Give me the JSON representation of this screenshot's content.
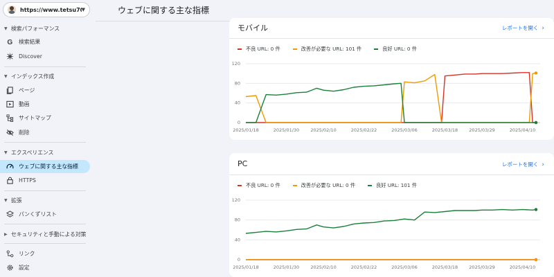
{
  "property": {
    "url": "https://www.tetsu7017..."
  },
  "page": {
    "title": "ウェブに関する主な指標"
  },
  "sidebar": {
    "sections": [
      {
        "label": "検索パフォーマンス",
        "items": [
          {
            "label": "検索結果",
            "icon": "google-g-icon"
          },
          {
            "label": "Discover",
            "icon": "discover-star-icon"
          }
        ]
      },
      {
        "label": "インデックス作成",
        "items": [
          {
            "label": "ページ",
            "icon": "pages-icon"
          },
          {
            "label": "動画",
            "icon": "video-icon"
          },
          {
            "label": "サイトマップ",
            "icon": "sitemap-icon"
          },
          {
            "label": "削除",
            "icon": "removal-icon"
          }
        ]
      },
      {
        "label": "エクスペリエンス",
        "items": [
          {
            "label": "ウェブに関する主な指標",
            "icon": "speed-icon",
            "active": true
          },
          {
            "label": "HTTPS",
            "icon": "lock-icon"
          }
        ]
      },
      {
        "label": "拡張",
        "items": [
          {
            "label": "パンくずリスト",
            "icon": "layers-icon"
          }
        ]
      },
      {
        "label": "セキュリティと手動による対策",
        "items": []
      }
    ],
    "bottom_items": [
      {
        "label": "リンク",
        "icon": "links-icon"
      },
      {
        "label": "設定",
        "icon": "settings-icon"
      }
    ]
  },
  "colors": {
    "poor": "#d93025",
    "needs_improvement": "#f29900",
    "good": "#188038",
    "link": "#1a73e8",
    "active_bg": "#c2e7ff"
  },
  "cards": [
    {
      "title": "モバイル",
      "report_link": "レポートを開く",
      "legend": [
        {
          "label": "不良 URL: 0 件"
        },
        {
          "label": "改善が必要な URL: 101 件"
        },
        {
          "label": "良好 URL: 0 件"
        }
      ]
    },
    {
      "title": "PC",
      "report_link": "レポートを開く",
      "legend": [
        {
          "label": "不良 URL: 0 件"
        },
        {
          "label": "改善が必要な URL: 0 件"
        },
        {
          "label": "良好 URL: 101 件"
        }
      ]
    }
  ],
  "chart_data": [
    {
      "type": "line",
      "title": "モバイル",
      "x": [
        "2025/01/18",
        "2025/01/21",
        "2025/01/24",
        "2025/01/27",
        "2025/01/30",
        "2025/02/02",
        "2025/02/05",
        "2025/02/08",
        "2025/02/10",
        "2025/02/13",
        "2025/02/16",
        "2025/02/19",
        "2025/02/22",
        "2025/02/25",
        "2025/02/28",
        "2025/03/03",
        "2025/03/05",
        "2025/03/06",
        "2025/03/09",
        "2025/03/12",
        "2025/03/15",
        "2025/03/17",
        "2025/03/18",
        "2025/03/21",
        "2025/03/24",
        "2025/03/27",
        "2025/03/29",
        "2025/04/01",
        "2025/04/04",
        "2025/04/07",
        "2025/04/10",
        "2025/04/12",
        "2025/04/13",
        "2025/04/14"
      ],
      "x_ticks": [
        "2025/01/18",
        "2025/01/30",
        "2025/02/10",
        "2025/02/22",
        "2025/03/06",
        "2025/03/18",
        "2025/03/29",
        "2025/04/10"
      ],
      "ylim": [
        0,
        120
      ],
      "y_ticks": [
        0,
        40,
        80,
        120
      ],
      "grid": true,
      "series": [
        {
          "name": "不良",
          "color": "#d93025",
          "values": [
            0,
            0,
            0,
            0,
            0,
            0,
            0,
            0,
            0,
            0,
            0,
            0,
            0,
            0,
            0,
            0,
            0,
            0,
            0,
            0,
            0,
            0,
            95,
            97,
            99,
            99,
            100,
            100,
            100,
            101,
            102,
            102,
            0,
            0
          ]
        },
        {
          "name": "改善が必要",
          "color": "#f29900",
          "values": [
            53,
            55,
            0,
            0,
            0,
            0,
            0,
            0,
            0,
            0,
            0,
            0,
            0,
            0,
            0,
            0,
            0,
            83,
            81,
            85,
            98,
            0,
            0,
            0,
            0,
            0,
            0,
            0,
            0,
            0,
            0,
            0,
            100,
            101
          ]
        },
        {
          "name": "良好",
          "color": "#188038",
          "values": [
            0,
            0,
            57,
            56,
            58,
            61,
            62,
            70,
            66,
            64,
            67,
            72,
            74,
            75,
            77,
            79,
            80,
            0,
            0,
            0,
            0,
            0,
            0,
            0,
            0,
            0,
            0,
            0,
            0,
            0,
            0,
            0,
            0,
            0
          ]
        }
      ]
    },
    {
      "type": "line",
      "title": "PC",
      "x": [
        "2025/01/18",
        "2025/01/21",
        "2025/01/24",
        "2025/01/27",
        "2025/01/30",
        "2025/02/02",
        "2025/02/05",
        "2025/02/08",
        "2025/02/10",
        "2025/02/13",
        "2025/02/16",
        "2025/02/19",
        "2025/02/22",
        "2025/02/25",
        "2025/02/28",
        "2025/03/03",
        "2025/03/06",
        "2025/03/09",
        "2025/03/12",
        "2025/03/15",
        "2025/03/18",
        "2025/03/21",
        "2025/03/24",
        "2025/03/27",
        "2025/03/29",
        "2025/04/01",
        "2025/04/04",
        "2025/04/07",
        "2025/04/10",
        "2025/04/13",
        "2025/04/14"
      ],
      "x_ticks": [
        "2025/01/18",
        "2025/01/30",
        "2025/02/10",
        "2025/02/22",
        "2025/03/06",
        "2025/03/18",
        "2025/03/29",
        "2025/04/10"
      ],
      "ylim": [
        0,
        120
      ],
      "y_ticks": [
        0,
        40,
        80,
        120
      ],
      "grid": true,
      "series": [
        {
          "name": "不良",
          "color": "#d93025",
          "values": [
            0,
            0,
            0,
            0,
            0,
            0,
            0,
            0,
            0,
            0,
            0,
            0,
            0,
            0,
            0,
            0,
            0,
            0,
            0,
            0,
            0,
            0,
            0,
            0,
            0,
            0,
            0,
            0,
            0,
            0,
            0
          ]
        },
        {
          "name": "改善が必要",
          "color": "#f29900",
          "values": [
            0,
            0,
            0,
            0,
            0,
            0,
            0,
            0,
            0,
            0,
            0,
            0,
            0,
            0,
            0,
            0,
            0,
            0,
            0,
            0,
            0,
            0,
            0,
            0,
            0,
            0,
            0,
            0,
            0,
            0,
            0
          ]
        },
        {
          "name": "良好",
          "color": "#188038",
          "values": [
            53,
            55,
            57,
            56,
            58,
            61,
            62,
            70,
            66,
            64,
            67,
            72,
            74,
            75,
            78,
            79,
            82,
            80,
            96,
            95,
            97,
            99,
            99,
            99,
            100,
            100,
            101,
            100,
            101,
            100,
            101
          ]
        }
      ]
    }
  ]
}
